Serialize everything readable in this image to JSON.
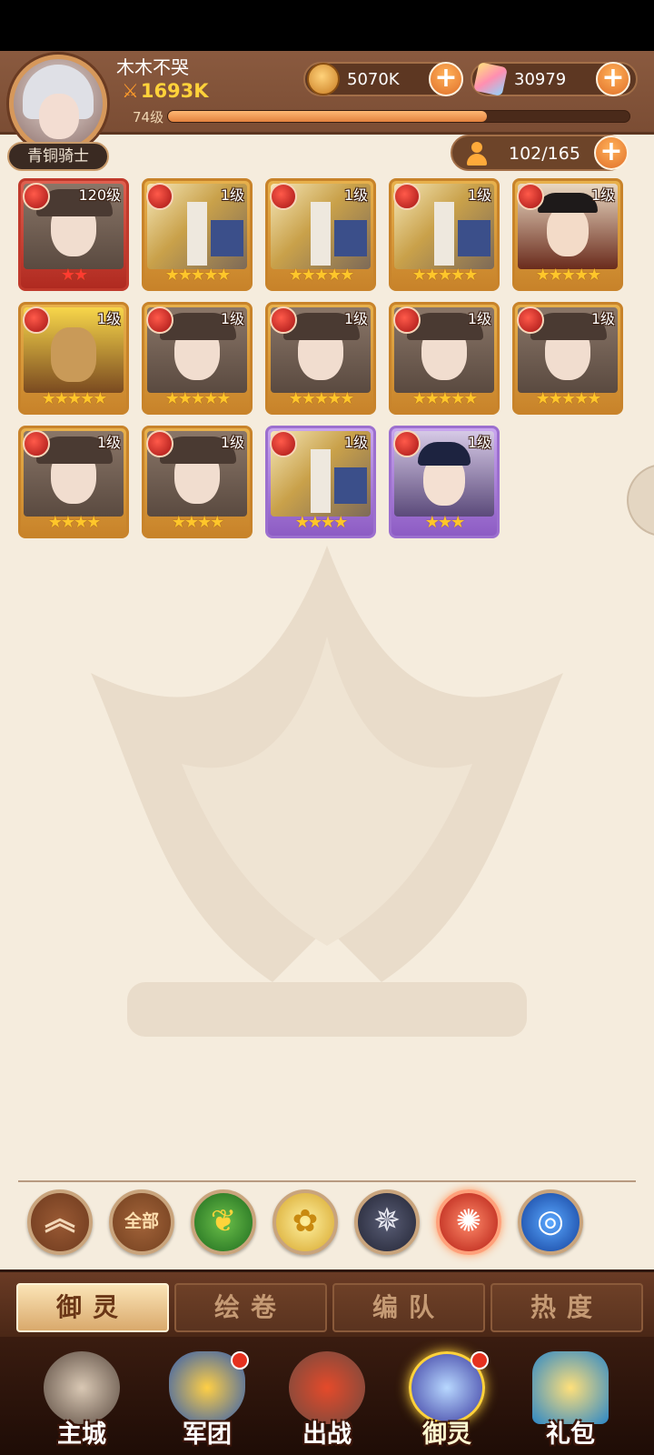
{
  "player": {
    "name": "木木不哭",
    "power": "1693K",
    "level_label": "74级",
    "exp_fraction": 0.69,
    "rank": "青铜骑士"
  },
  "currencies": {
    "gold": "5070K",
    "gems": "30979"
  },
  "hero_count": "102/165",
  "plus_symbol": "+",
  "heroes": [
    {
      "level": "120级",
      "stars": 2,
      "frame": "red",
      "portrait": "girl"
    },
    {
      "level": "1级",
      "stars": 5,
      "frame": "gold",
      "portrait": "knight"
    },
    {
      "level": "1级",
      "stars": 5,
      "frame": "gold",
      "portrait": "knight"
    },
    {
      "level": "1级",
      "stars": 5,
      "frame": "gold",
      "portrait": "knight"
    },
    {
      "level": "1级",
      "stars": 5,
      "frame": "gold",
      "portrait": "warrior"
    },
    {
      "level": "1级",
      "stars": 5,
      "frame": "gold",
      "portrait": "golden"
    },
    {
      "level": "1级",
      "stars": 5,
      "frame": "gold",
      "portrait": "girl"
    },
    {
      "level": "1级",
      "stars": 5,
      "frame": "gold",
      "portrait": "girl"
    },
    {
      "level": "1级",
      "stars": 5,
      "frame": "gold",
      "portrait": "girl"
    },
    {
      "level": "1级",
      "stars": 5,
      "frame": "gold",
      "portrait": "girl"
    },
    {
      "level": "1级",
      "stars": 4,
      "frame": "gold",
      "portrait": "girl"
    },
    {
      "level": "1级",
      "stars": 4,
      "frame": "gold",
      "portrait": "girl"
    },
    {
      "level": "1级",
      "stars": 4,
      "frame": "purple",
      "portrait": "knight"
    },
    {
      "level": "1级",
      "stars": 3,
      "frame": "purple",
      "portrait": "scholar"
    }
  ],
  "filters": {
    "up_icon": "︽",
    "all_label": "全部",
    "leaf_icon": "❦",
    "rose_icon": "✿",
    "dark_icon": "✵",
    "fire_icon": "✺",
    "water_icon": "◎"
  },
  "tabs": [
    "御灵",
    "绘卷",
    "编队",
    "热度"
  ],
  "nav": {
    "city": "主城",
    "legion": "军团",
    "battle": "出战",
    "yuling": "御灵",
    "gift": "礼包"
  },
  "colors": {
    "star": "#ffc62a",
    "star_red": "#ff3b30",
    "accent": "#e0702a"
  }
}
